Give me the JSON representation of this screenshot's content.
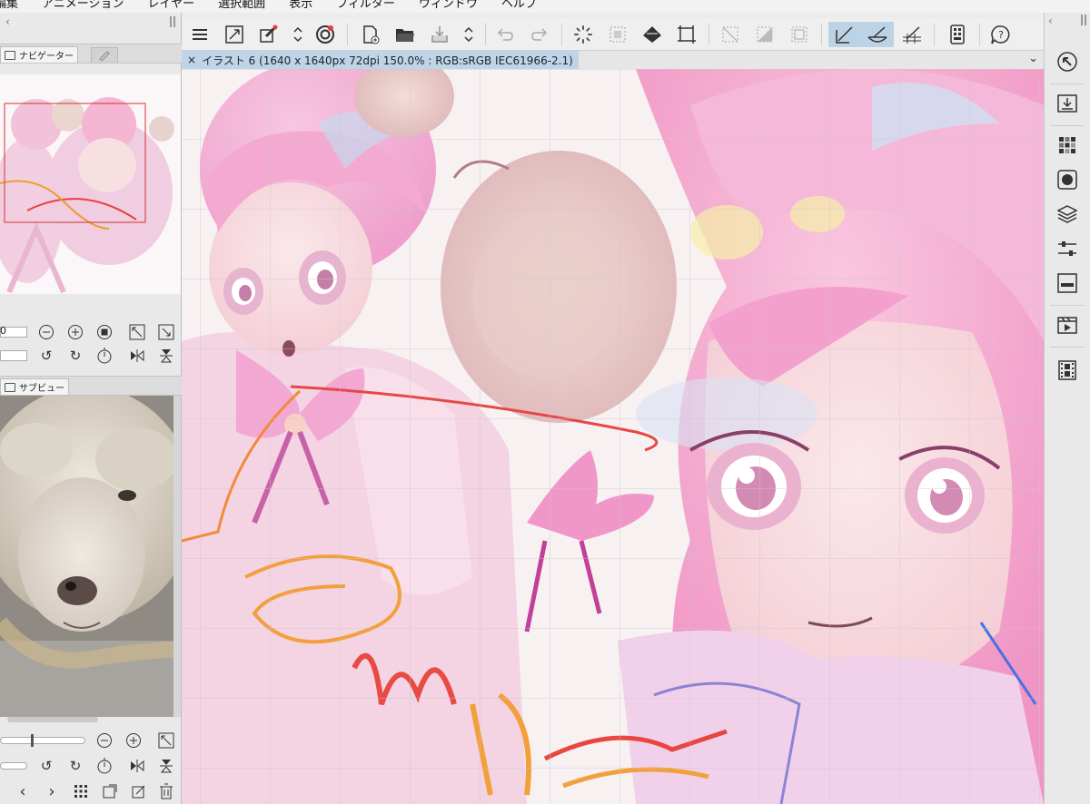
{
  "menubar": {
    "items": [
      "編集",
      "アニメーション",
      "レイヤー",
      "選択範囲",
      "表示",
      "フィルター",
      "ウィンドウ",
      "ヘルプ"
    ]
  },
  "panels": {
    "navigator": {
      "tab_label": "ナビゲーター"
    },
    "subview": {
      "tab_label": "サブビュー"
    }
  },
  "navigator_controls": {
    "zoom_value": "0"
  },
  "document": {
    "tab_label": "イラスト 6 (1640 x 1640px 72dpi 150.0% : RGB:sRGB IEC61966-2.1)"
  },
  "toolbar": {
    "groups": [
      [
        "menu-icon",
        "fit-canvas-icon",
        "correction-icon",
        "toggle-arrows-icon",
        "cloud-icon"
      ],
      [
        "new-document-icon",
        "open-folder-icon",
        "save-icon",
        "toggle-arrows-icon"
      ],
      [
        "undo-icon",
        "redo-icon"
      ],
      [
        "loading-spinner-icon",
        "dashed-select-icon",
        "fill-icon",
        "crop-icon"
      ],
      [
        "clear-selection-icon",
        "invert-selection-icon",
        "show-selection-icon"
      ],
      [
        "snap-ruler-icon",
        "snap-special-ruler-icon",
        "snap-grid-icon"
      ],
      [
        "tablet-icon"
      ],
      [
        "help-icon"
      ]
    ],
    "active": [
      "snap-ruler-icon",
      "snap-special-ruler-icon"
    ]
  },
  "right_rail": {
    "icons": [
      "navigate-icon",
      "import-icon",
      "color-set-icon",
      "color-circle-icon",
      "layers-icon",
      "tool-property-icon",
      "layer-property-icon",
      "timeline-icon",
      "animation-cels-icon"
    ]
  },
  "colors": {
    "accent_active": "#bcd3e6",
    "document_tab": "#bed5e8",
    "canvas_bg": "#f6efef",
    "navigator_frame": "#d33333",
    "ui_bg": "#e9e9e9"
  }
}
